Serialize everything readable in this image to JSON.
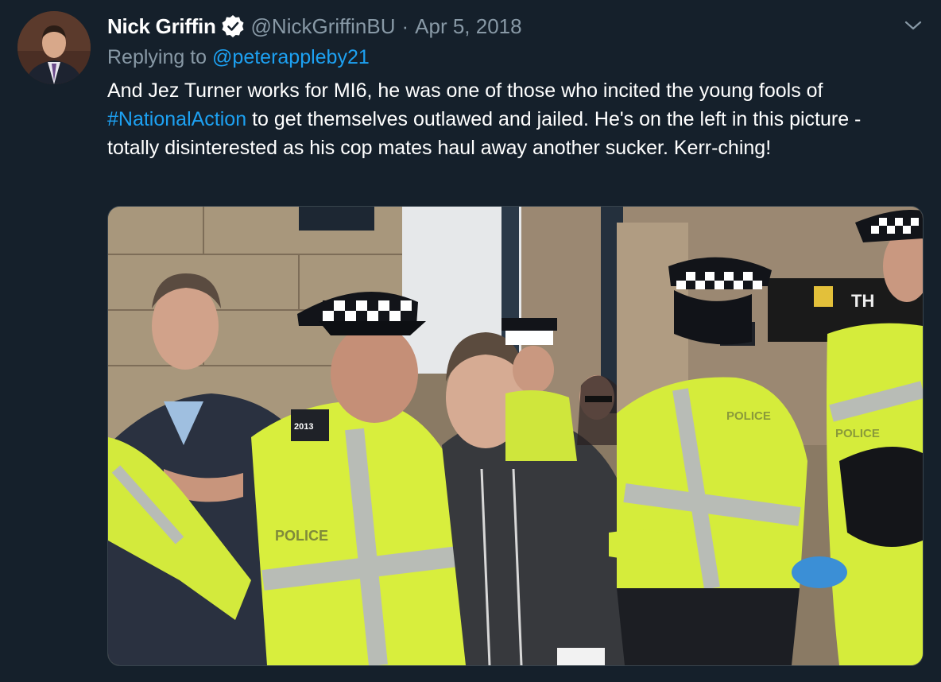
{
  "tweet": {
    "author_name": "Nick Griffin",
    "verified": true,
    "handle": "@NickGriffinBU",
    "separator": "·",
    "date": "Apr 5, 2018",
    "replying_prefix": "Replying to",
    "replying_to": "@peterappleby21",
    "text_part1": "And Jez Turner works for MI6, he was one of those who incited the young fools of ",
    "hashtag": "#NationalAction",
    "text_part2": " to get themselves outlawed and jailed. He's on the left in this picture - totally disinterested as his cop mates haul away another sucker. Kerr-ching!",
    "photo": {
      "vest_labels": [
        "POLICE",
        "POLICE",
        "POLICE"
      ],
      "shoulder_number": "2013",
      "background_sign": "TH"
    }
  },
  "icons": {
    "verified": "verified-badge-icon",
    "more": "chevron-down-icon"
  },
  "colors": {
    "background": "#15202b",
    "primary_text": "#ffffff",
    "secondary_text": "#8899a6",
    "link": "#1da1f2",
    "hi_vis": "#d7f03a"
  }
}
